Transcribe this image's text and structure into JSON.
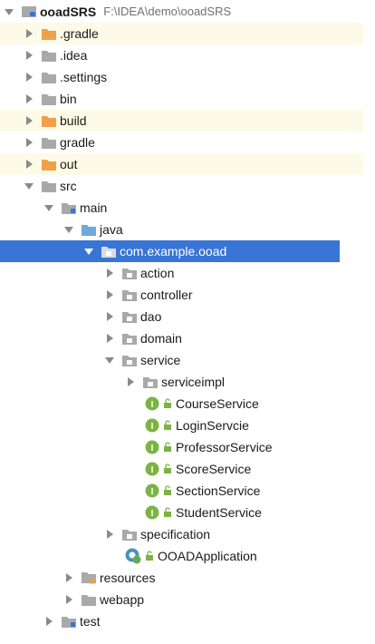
{
  "project": {
    "name": "ooadSRS",
    "path": "F:\\IDEA\\demo\\ooadSRS"
  },
  "tree": {
    "gradle_dot": ".gradle",
    "idea": ".idea",
    "settings": ".settings",
    "bin": "bin",
    "build": "build",
    "gradle": "gradle",
    "out": "out",
    "src": "src",
    "main": "main",
    "java": "java",
    "package": "com.example.ooad",
    "action": "action",
    "controller": "controller",
    "dao": "dao",
    "domain": "domain",
    "service": "service",
    "serviceimpl": "serviceimpl",
    "interfaces": [
      "CourseService",
      "LoginServcie",
      "ProfessorService",
      "ScoreService",
      "SectionService",
      "StudentService"
    ],
    "specification": "specification",
    "app": "OOADApplication",
    "resources": "resources",
    "webapp": "webapp",
    "test": "test"
  },
  "colors": {
    "selection": "#3875d6",
    "excluded_highlight": "#fdfbe7",
    "orange_folder": "#f0a04b",
    "grey_folder": "#a9a9a9",
    "source_folder": "#6fa8dc",
    "interface_badge": "#7cb342"
  }
}
